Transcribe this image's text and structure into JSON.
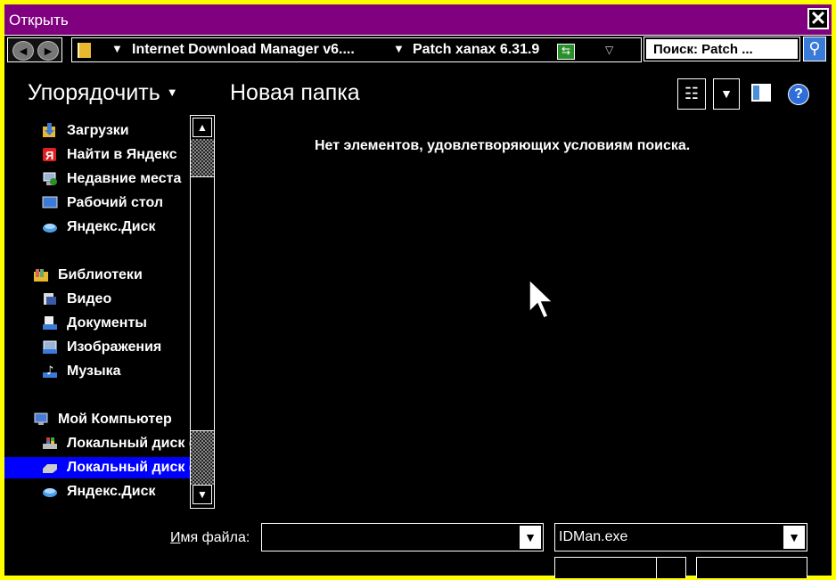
{
  "window": {
    "title": "Открыть",
    "close_glyph": "✕",
    "colors": {
      "border": "#ffff00",
      "titlebar": "#800080",
      "background": "#000000",
      "selection": "#0000ff"
    }
  },
  "address": {
    "back_glyph": "◄",
    "forward_glyph": "►",
    "crumbs": [
      "Internet Download Manager v6....",
      "Patch xanax 6.31.9"
    ],
    "crumb_arrow": "▼",
    "history_arrow": "▽",
    "refresh_glyph": "⇆"
  },
  "search": {
    "placeholder": "Поиск: Patch ...",
    "button_glyph": "⚲"
  },
  "toolbar": {
    "organize_label": "Упорядочить",
    "organize_arrow": "▼",
    "new_folder_label": "Новая папка",
    "view_glyph": "☷",
    "view_dd_glyph": "▼",
    "help_glyph": "?"
  },
  "nav": {
    "items": [
      {
        "label": "Загрузки",
        "icon": "downloads-icon"
      },
      {
        "label": "Найти в Яндекс",
        "icon": "yandex-icon"
      },
      {
        "label": "Недавние места",
        "icon": "recent-places-icon"
      },
      {
        "label": "Рабочий стол",
        "icon": "desktop-icon"
      },
      {
        "label": "Яндекс.Диск",
        "icon": "yandex-disk-icon"
      },
      {
        "label": "Библиотеки",
        "icon": "libraries-icon"
      },
      {
        "label": "Видео",
        "icon": "video-library-icon"
      },
      {
        "label": "Документы",
        "icon": "documents-library-icon"
      },
      {
        "label": "Изображения",
        "icon": "pictures-library-icon"
      },
      {
        "label": "Музыка",
        "icon": "music-library-icon"
      },
      {
        "label": "Мой Компьютер",
        "icon": "computer-icon"
      },
      {
        "label": "Локальный диск (C:)",
        "icon": "windows-drive-icon"
      },
      {
        "label": "Локальный диск (D:)",
        "icon": "drive-icon",
        "selected": true
      },
      {
        "label": "Яндекс.Диск",
        "icon": "yandex-disk-icon"
      }
    ]
  },
  "scroll": {
    "up_glyph": "▲",
    "down_glyph": "▼"
  },
  "content": {
    "empty_message": "Нет элементов, удовлетворяющих условиям поиска."
  },
  "bottom": {
    "filename_label_underlined": "И",
    "filename_label_rest": "мя файла:",
    "filename_value": "",
    "filetype_value": "IDMan.exe",
    "dd_glyph": "▼"
  }
}
